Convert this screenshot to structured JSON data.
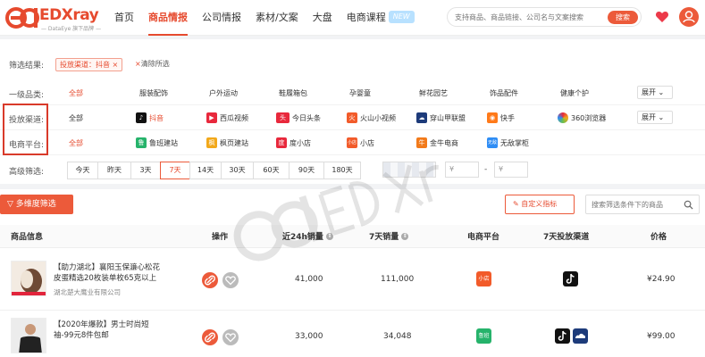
{
  "header": {
    "logo_text": "EDXray",
    "logo_sub": "— DataEye 旗下品牌 —",
    "nav": [
      {
        "label": "首页",
        "active": false
      },
      {
        "label": "商品情报",
        "active": true
      },
      {
        "label": "公司情报",
        "active": false
      },
      {
        "label": "素材/文案",
        "active": false
      },
      {
        "label": "大盘",
        "active": false
      },
      {
        "label": "电商课程",
        "active": false
      }
    ],
    "new_badge": "NEW",
    "search_placeholder": "支持商品、商品链接、公司名与文案搜索",
    "search_button": "搜索",
    "brand_color": "#ec5a3a"
  },
  "filters": {
    "result_label": "筛选结果:",
    "result_tag": "投放渠道：抖音 ×",
    "clear_x": "×",
    "clear_label": "清除所选",
    "category": {
      "label": "一级品类:",
      "options": [
        "全部",
        "服装配饰",
        "户外运动",
        "鞋履箱包",
        "孕婴童",
        "鲜花园艺",
        "饰品配件",
        "健康个护"
      ],
      "expand": "展开"
    },
    "channel": {
      "label": "投放渠道:",
      "options": [
        {
          "label": "全部",
          "icon": "",
          "color": ""
        },
        {
          "label": "抖音",
          "icon": "douyin-icon",
          "color": "#111111"
        },
        {
          "label": "西瓜视频",
          "icon": "xigua-icon",
          "color": "#e8283c"
        },
        {
          "label": "今日头条",
          "icon": "toutiao-icon",
          "color": "#e8283c"
        },
        {
          "label": "火山小视频",
          "icon": "huoshan-icon",
          "color": "#f25b2a"
        },
        {
          "label": "穿山甲联盟",
          "icon": "pangle-icon",
          "color": "#1d3b7a"
        },
        {
          "label": "快手",
          "icon": "kuaishou-icon",
          "color": "#ff7a1a"
        },
        {
          "label": "360浏览器",
          "icon": "360-icon",
          "color": "#6bc04b"
        }
      ],
      "expand": "展开"
    },
    "platform": {
      "label": "电商平台:",
      "options": [
        {
          "label": "全部",
          "icon": "",
          "color": ""
        },
        {
          "label": "鲁班建站",
          "icon": "luban-icon",
          "color": "#26b36b"
        },
        {
          "label": "枫页建站",
          "icon": "fengye-icon",
          "color": "#f2a81a"
        },
        {
          "label": "度小店",
          "icon": "duxiaodian-icon",
          "color": "#e8283c"
        },
        {
          "label": "小店",
          "icon": "xiaodian-icon",
          "color": "#f25b2a"
        },
        {
          "label": "金牛电商",
          "icon": "jinniu-icon",
          "color": "#f27a1a"
        },
        {
          "label": "无敌掌柜",
          "icon": "wudi-icon",
          "color": "#2f8df5"
        }
      ],
      "icon_text": {
        "luban": "鲁",
        "fengye": "枫",
        "duxiaodian": "度",
        "xiaodian": "小店",
        "jinniu": "牛",
        "wudi": "无敌"
      }
    },
    "advanced": {
      "label": "高级筛选:",
      "time_options": [
        "今天",
        "昨天",
        "3天",
        "7天",
        "14天",
        "30天",
        "60天",
        "90天",
        "180天"
      ],
      "selected": "7天",
      "yen1": "¥",
      "dash": "-",
      "yen2": "¥"
    }
  },
  "toolbar": {
    "multi_filter": "多维度筛选",
    "custom_metric": "自定义指标",
    "cond_search_placeholder": "搜索筛选条件下的商品"
  },
  "table": {
    "headers": {
      "info": "商品信息",
      "action": "操作",
      "sales24": "近24h销量",
      "sales7": "7天销量",
      "platform": "电商平台",
      "channel": "7天投放渠道",
      "price": "价格"
    },
    "rows": [
      {
        "name": "【助力湖北】襄阳玉保濂心松花皮蛋精选20枚装单枚65克以上",
        "shop": "湖北楚大鹰业有限公司",
        "sales24": "41,000",
        "sales7": "111,000",
        "platform_icon": "xiaodian-icon",
        "platform_text": "小店",
        "platform_color": "#f25b2a",
        "channels": [
          "douyin-icon"
        ],
        "price": "¥24.90"
      },
      {
        "name": "【2020年爆款】男士时尚短袖-99元8件包邮",
        "shop": "",
        "sales24": "33,000",
        "sales7": "34,048",
        "platform_icon": "luban-icon",
        "platform_text": "鲁班",
        "platform_color": "#26b36b",
        "channels": [
          "douyin-icon",
          "pangle-icon"
        ],
        "price": "¥99.00"
      }
    ]
  }
}
